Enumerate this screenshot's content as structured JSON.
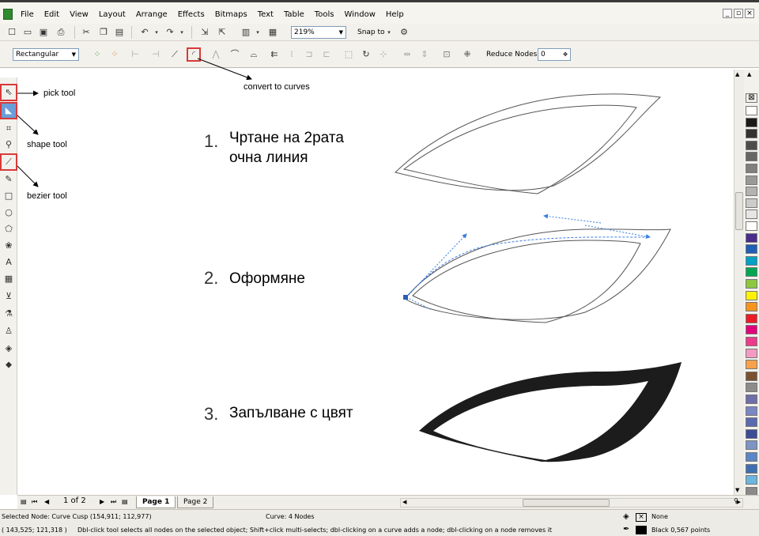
{
  "menu": {
    "items": [
      "File",
      "Edit",
      "View",
      "Layout",
      "Arrange",
      "Effects",
      "Bitmaps",
      "Text",
      "Table",
      "Tools",
      "Window",
      "Help"
    ]
  },
  "toolbar": {
    "zoom_value": "219%",
    "snap_to_label": "Snap to"
  },
  "property_bar": {
    "selection_mode": "Rectangular",
    "reduce_nodes_label": "Reduce Nodes",
    "reduce_nodes_value": "0"
  },
  "annotations": {
    "pick_tool": "pick tool",
    "shape_tool": "shape tool",
    "bezier_tool": "bezier tool",
    "convert_to_curves": "convert to curves"
  },
  "steps": [
    {
      "number": "1.",
      "text_line1": "Чртане на 2рата",
      "text_line2": "очна линия"
    },
    {
      "number": "2.",
      "text_line1": "Оформяне",
      "text_line2": ""
    },
    {
      "number": "3.",
      "text_line1": "Запълване с цвят",
      "text_line2": ""
    }
  ],
  "pagebar": {
    "page_counter": "1 of 2",
    "tabs": [
      "Page 1",
      "Page 2"
    ]
  },
  "status": {
    "selected_node": "Selected Node: Curve Cusp (154,911; 112,977)",
    "curve_info": "Curve: 4 Nodes",
    "coords": "( 143,525; 121,318 )",
    "hint": "Dbl-click tool selects all nodes on the selected object; Shift+click multi-selects; dbl-clicking on a curve adds a node; dbl-clicking on a node removes it",
    "fill_label": "None",
    "outline_label": "Black  0,567 points"
  },
  "palette_colors": [
    "#ffffff",
    "#1a1a1a",
    "#333333",
    "#4d4d4d",
    "#666666",
    "#808080",
    "#999999",
    "#b3b3b3",
    "#cccccc",
    "#e6e6e6",
    "#ffffff",
    "#4b2c8c",
    "#1f5fb5",
    "#00a0c6",
    "#00a651",
    "#8dc63f",
    "#fff200",
    "#f7941d",
    "#ed1c24",
    "#e2007a",
    "#ee3a8c",
    "#f49ac1",
    "#f7a24a",
    "#7a5230",
    "#8c8c8c",
    "#6e6ea8",
    "#7b86c4",
    "#5b6ab0",
    "#3d4c96",
    "#7d94c4",
    "#5b87c7",
    "#3f6fb2",
    "#6cb6e0",
    "#8a8a8a"
  ]
}
